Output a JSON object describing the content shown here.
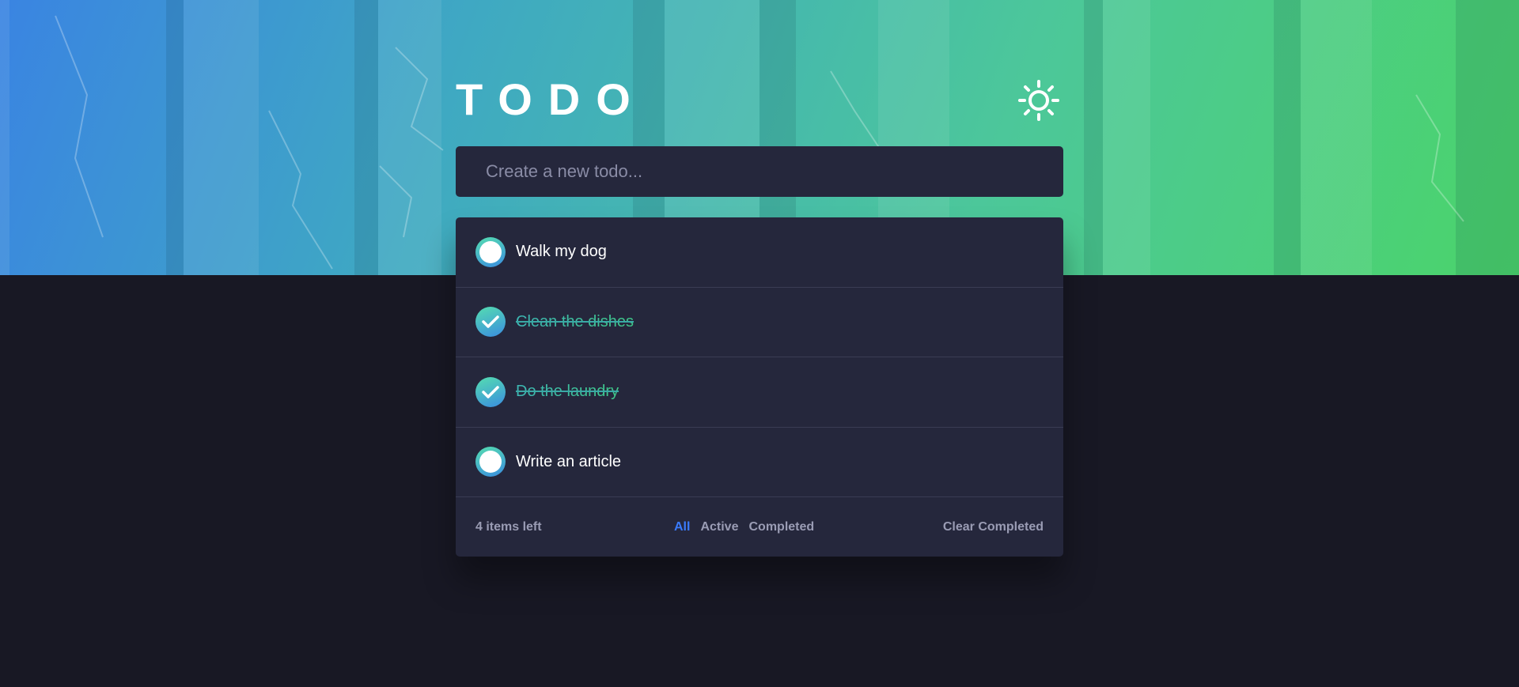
{
  "header": {
    "title": "TODO",
    "theme_icon": "sun-icon"
  },
  "new_todo": {
    "placeholder": "Create a new todo..."
  },
  "todos": [
    {
      "label": "Walk my dog",
      "completed": false
    },
    {
      "label": "Clean the dishes",
      "completed": true
    },
    {
      "label": "Do the laundry",
      "completed": true
    },
    {
      "label": "Write an article",
      "completed": false
    }
  ],
  "footer": {
    "items_left": "4 items left",
    "filters": {
      "all": "All",
      "active": "Active",
      "completed": "Completed"
    },
    "active_filter": "All",
    "clear": "Clear Completed"
  },
  "colors": {
    "background": "#181824",
    "card": "#25273c",
    "accent": "#3a7bfd",
    "gradient_start": "#55ddb0",
    "gradient_end": "#3a8de0"
  }
}
